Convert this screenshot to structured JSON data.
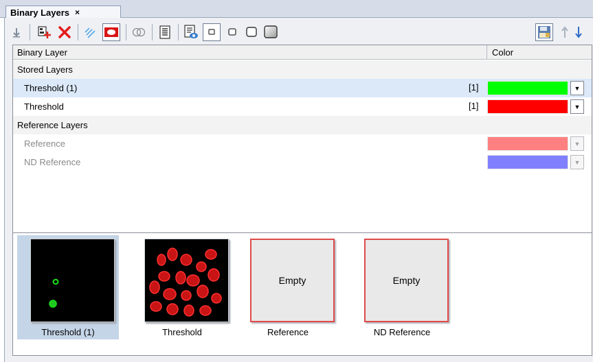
{
  "tab": {
    "title": "Binary Layers",
    "close": "×"
  },
  "toolbar": {
    "buttons": [
      {
        "name": "move-down-icon",
        "glyph": "↓"
      },
      {
        "name": "add-layer-icon"
      },
      {
        "name": "delete-icon",
        "glyph": "✕"
      },
      {
        "name": "sparkle-icon",
        "glyph": "✧"
      },
      {
        "name": "fill-mode-icon"
      },
      {
        "name": "intersect-icon",
        "glyph": "◯◯"
      },
      {
        "name": "list-icon",
        "glyph": "☰"
      },
      {
        "name": "view-icon"
      },
      {
        "name": "size-tiny-icon"
      },
      {
        "name": "size-small-icon"
      },
      {
        "name": "size-medium-icon"
      },
      {
        "name": "size-large-icon"
      },
      {
        "name": "save-icon"
      },
      {
        "name": "arrow-up-icon",
        "glyph": "↑"
      },
      {
        "name": "arrow-down-icon",
        "glyph": "↓"
      }
    ]
  },
  "columns": {
    "name": "Binary Layer",
    "color": "Color"
  },
  "groups": {
    "stored": "Stored Layers",
    "reference": "Reference Layers"
  },
  "stored_layers": [
    {
      "name": "Threshold (1)",
      "count": "[1]",
      "color": "#00ff00",
      "selected": true
    },
    {
      "name": "Threshold",
      "count": "[1]",
      "color": "#ff0000",
      "selected": false
    }
  ],
  "reference_layers": [
    {
      "name": "Reference",
      "color": "#ff8080"
    },
    {
      "name": "ND Reference",
      "color": "#8080ff"
    }
  ],
  "thumbnails": [
    {
      "label": "Threshold (1)",
      "state": "image",
      "selected": true,
      "image_color": "#00ff00"
    },
    {
      "label": "Threshold",
      "state": "image",
      "selected": false,
      "image_color": "#ff0000"
    },
    {
      "label": "Reference",
      "state": "Empty",
      "selected": false
    },
    {
      "label": "ND Reference",
      "state": "Empty",
      "selected": false
    }
  ]
}
